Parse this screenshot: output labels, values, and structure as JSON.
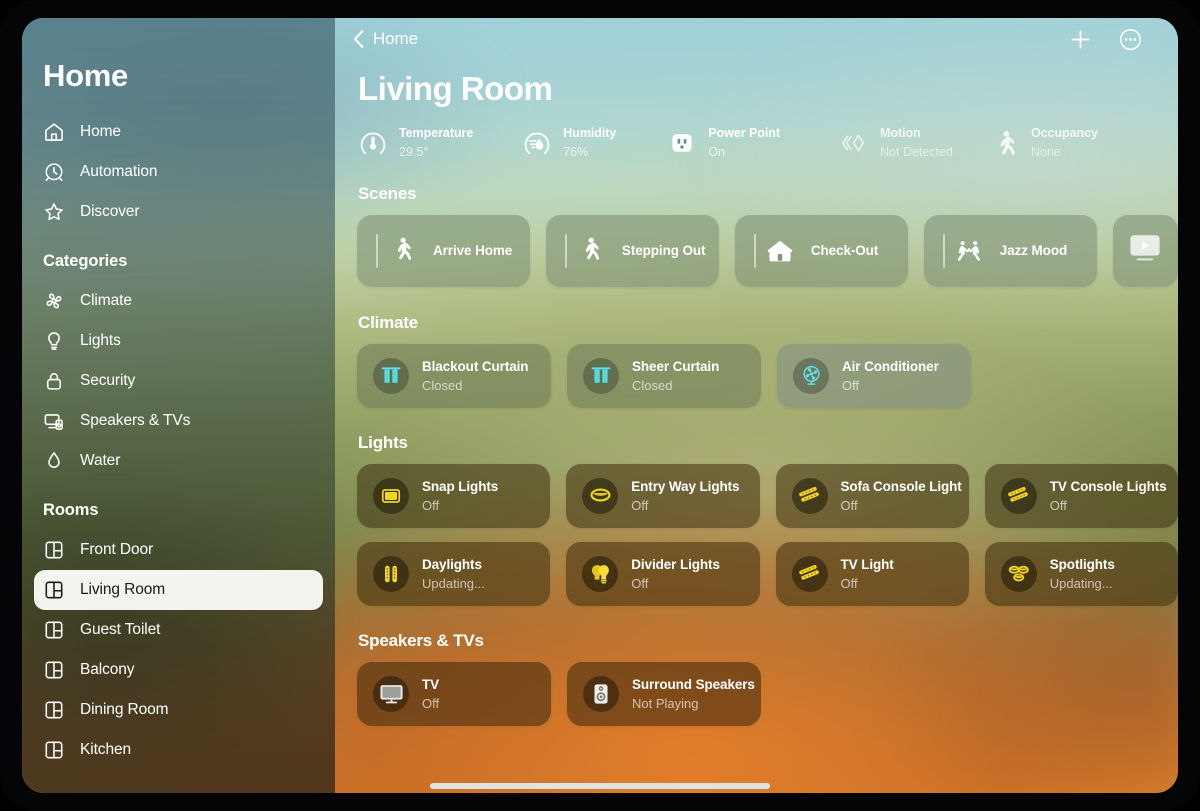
{
  "sidebar": {
    "title": "Home",
    "nav": [
      {
        "label": "Home",
        "icon": "home-icon"
      },
      {
        "label": "Automation",
        "icon": "clock-icon"
      },
      {
        "label": "Discover",
        "icon": "star-icon"
      }
    ],
    "categories_header": "Categories",
    "categories": [
      {
        "label": "Climate",
        "icon": "fan-icon"
      },
      {
        "label": "Lights",
        "icon": "bulb-icon"
      },
      {
        "label": "Security",
        "icon": "lock-icon"
      },
      {
        "label": "Speakers & TVs",
        "icon": "tv-speaker-icon"
      },
      {
        "label": "Water",
        "icon": "droplet-icon"
      }
    ],
    "rooms_header": "Rooms",
    "rooms": [
      {
        "label": "Front Door",
        "icon": "room-icon",
        "selected": false
      },
      {
        "label": "Living Room",
        "icon": "room-icon",
        "selected": true
      },
      {
        "label": "Guest Toilet",
        "icon": "room-icon",
        "selected": false
      },
      {
        "label": "Balcony",
        "icon": "room-icon",
        "selected": false
      },
      {
        "label": "Dining Room",
        "icon": "room-icon",
        "selected": false
      },
      {
        "label": "Kitchen",
        "icon": "room-icon",
        "selected": false
      }
    ]
  },
  "navbar": {
    "back_label": "Home",
    "add_icon": "plus-icon",
    "more_icon": "ellipsis-circle-icon"
  },
  "main": {
    "room_title": "Living Room",
    "sensors": [
      {
        "name": "Temperature",
        "value": "29.5°",
        "icon": "thermometer-gauge-icon"
      },
      {
        "name": "Humidity",
        "value": "76%",
        "icon": "humidity-gauge-icon"
      },
      {
        "name": "Power Point",
        "value": "On",
        "icon": "power-outlet-icon"
      },
      {
        "name": "Motion",
        "value": "Not Detected",
        "icon": "motion-sensor-icon"
      },
      {
        "name": "Occupancy",
        "value": "None",
        "icon": "walking-person-icon"
      }
    ],
    "sections": [
      {
        "title": "Scenes",
        "kind": "scenes",
        "tiles": [
          {
            "name": "Arrive Home",
            "icon": "walking-person-icon"
          },
          {
            "name": "Stepping Out",
            "icon": "walking-person-icon"
          },
          {
            "name": "Check-Out",
            "icon": "house-icon"
          },
          {
            "name": "Jazz Mood",
            "icon": "dancers-icon"
          },
          {
            "name": "",
            "icon": "media-play-icon",
            "partial": true
          }
        ]
      },
      {
        "title": "Climate",
        "kind": "climate",
        "tiles": [
          {
            "name": "Blackout Curtain",
            "state": "Closed",
            "icon": "curtain-icon"
          },
          {
            "name": "Sheer Curtain",
            "state": "Closed",
            "icon": "curtain-icon"
          },
          {
            "name": "Air Conditioner",
            "state": "Off",
            "icon": "fan-circle-icon"
          }
        ]
      },
      {
        "title": "Lights",
        "kind": "lights",
        "tiles": [
          {
            "name": "Snap Lights",
            "state": "Off",
            "icon": "panel-light-icon"
          },
          {
            "name": "Entry Way Lights",
            "state": "Off",
            "icon": "oval-light-icon"
          },
          {
            "name": "Sofa Console Light",
            "state": "Off",
            "icon": "strip-light-icon"
          },
          {
            "name": "TV Console Lights",
            "state": "Off",
            "icon": "strip-light-icon"
          },
          {
            "name": "Daylights",
            "state": "Updating...",
            "icon": "tube-light-icon"
          },
          {
            "name": "Divider Lights",
            "state": "Off",
            "icon": "double-bulb-icon"
          },
          {
            "name": "TV Light",
            "state": "Off",
            "icon": "strip-light-icon"
          },
          {
            "name": "Spotlights",
            "state": "Updating...",
            "icon": "triple-spot-icon"
          }
        ]
      },
      {
        "title": "Speakers & TVs",
        "kind": "media",
        "tiles": [
          {
            "name": "TV",
            "state": "Off",
            "icon": "television-icon"
          },
          {
            "name": "Surround Speakers",
            "state": "Not Playing",
            "icon": "speaker-icon"
          }
        ]
      }
    ]
  },
  "colors": {
    "accent_cyan": "#5fe0e8",
    "accent_yellow": "#f2d521",
    "selected_pill": "#f3f4ee",
    "text_primary": "#ffffff"
  }
}
